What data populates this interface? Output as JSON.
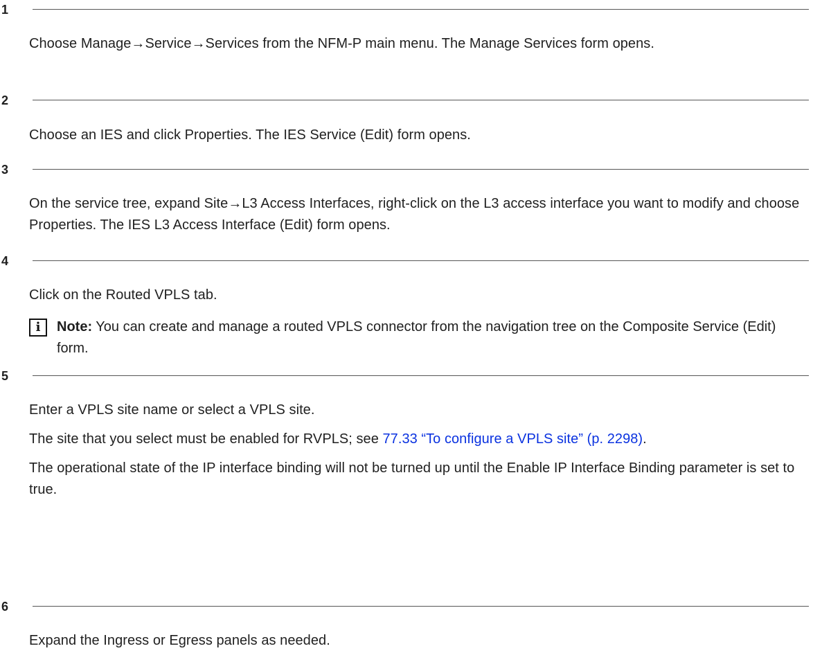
{
  "steps": [
    {
      "number": "1",
      "text": "Choose Manage→Service→Services from the NFM-P main menu. The Manage Services form opens."
    },
    {
      "number": "2",
      "text": "Choose an IES and click Properties. The IES Service (Edit) form opens."
    },
    {
      "number": "3",
      "text": "On the service tree, expand Site→L3 Access Interfaces, right-click on the L3 access interface you want to modify and choose Properties. The IES L3 Access Interface (Edit) form opens."
    },
    {
      "number": "4",
      "text": "Click on the Routed VPLS tab.",
      "note": {
        "icon": "info-icon",
        "icon_glyph": "i",
        "label": "Note:",
        "text": " You can create and manage a routed VPLS connector from the navigation tree on the Composite Service (Edit) form."
      }
    },
    {
      "number": "5",
      "text": "Enter a VPLS site name or select a VPLS site.",
      "para2_before": "The site that you select must be enabled for RVPLS; see ",
      "para2_link": "77.33 “To configure a VPLS site” (p. 2298)",
      "para2_after": ".",
      "para3": "The operational state of the IP interface binding will not be turned up until the Enable IP Interface Binding parameter is set to true."
    },
    {
      "number": "6",
      "text": "Expand the Ingress or Egress panels as needed."
    }
  ],
  "colors": {
    "text": "#1f1f1f",
    "link": "#0a32e0",
    "rule": "#555555"
  }
}
